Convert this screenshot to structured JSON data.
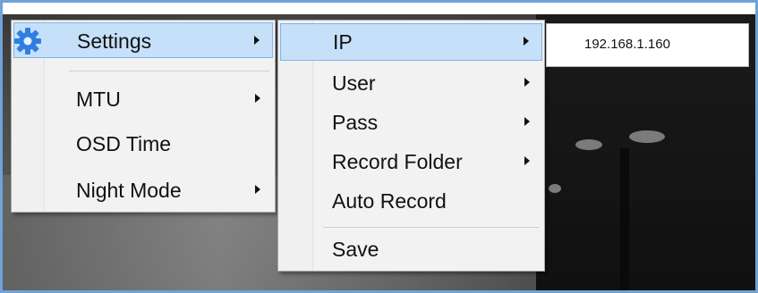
{
  "menu_main": {
    "items": [
      {
        "label": "Settings",
        "has_submenu": true,
        "highlighted": true,
        "icon": "gear-icon"
      },
      {
        "label": "MTU",
        "has_submenu": true
      },
      {
        "label": "OSD Time",
        "has_submenu": false
      },
      {
        "label": "Night Mode",
        "has_submenu": true
      }
    ]
  },
  "menu_settings": {
    "items": [
      {
        "label": "IP",
        "has_submenu": true,
        "highlighted": true
      },
      {
        "label": "User",
        "has_submenu": true
      },
      {
        "label": "Pass",
        "has_submenu": true
      },
      {
        "label": "Record Folder",
        "has_submenu": true
      },
      {
        "label": "Auto Record",
        "has_submenu": false
      },
      {
        "label": "Save",
        "has_submenu": false
      }
    ]
  },
  "ip_submenu": {
    "value": "192.168.1.160"
  },
  "colors": {
    "highlight_bg": "#c5e0f8",
    "highlight_border": "#7eb4ea",
    "menu_bg": "#f2f2f2",
    "gear_icon": "#2f7fe0",
    "frame_border": "#6fa3d8"
  }
}
